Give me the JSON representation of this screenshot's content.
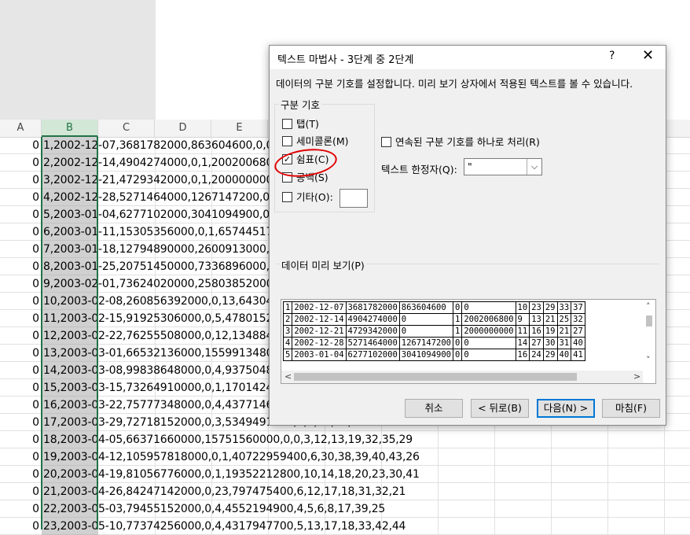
{
  "spreadsheet": {
    "columns": [
      "A",
      "B",
      "C",
      "D",
      "E"
    ],
    "rows": [
      {
        "a": "0",
        "text": "1,2002-12-07,3681782000,863604600,0,0,10"
      },
      {
        "a": "0",
        "text": "2,2002-12-14,4904274000,0,1,2002006800,9"
      },
      {
        "a": "0",
        "text": "3,2002-12-21,4729342000,0,1,2000000000,1"
      },
      {
        "a": "0",
        "text": "4,2002-12-28,5271464000,1267147200,0,0,1"
      },
      {
        "a": "0",
        "text": "5,2003-01-04,6277102000,3041094900,0,0,1"
      },
      {
        "a": "0",
        "text": "6,2003-01-11,15305356000,0,1,6574451700,"
      },
      {
        "a": "0",
        "text": "7,2003-01-18,12794890000,2600913000,0,0,"
      },
      {
        "a": "0",
        "text": "8,2003-01-25,20751450000,7336896000,0,0,"
      },
      {
        "a": "0",
        "text": "9,2003-02-01,73624020000,25803852000,0,0"
      },
      {
        "a": "0",
        "text": "10,2003-02-08,260856392000,0,13,64304379"
      },
      {
        "a": "0",
        "text": "11,2003-02-15,91925306000,0,5,4780152300"
      },
      {
        "a": "0",
        "text": "12,2003-02-22,76255508000,0,12,13488457"
      },
      {
        "a": "0",
        "text": "13,2003-03-01,66532136000,15599134800,0"
      },
      {
        "a": "0",
        "text": "14,2003-03-08,99838648000,0,4,9375048300"
      },
      {
        "a": "0",
        "text": "15,2003-03-15,73264910000,0,1,1701424500"
      },
      {
        "a": "0",
        "text": "16,2003-03-22,75777348000,0,4,4377146100"
      },
      {
        "a": "0",
        "text": "17,2003-03-29,72718152000,0,3,5349491200,1,4,18,23,31"
      },
      {
        "a": "0",
        "text": "18,2003-04-05,66371660000,15751560000,0,0,3,12,13,19,32,35,29"
      },
      {
        "a": "0",
        "text": "19,2003-04-12,105957818000,0,1,40722959400,6,30,38,39,40,43,26"
      },
      {
        "a": "0",
        "text": "20,2003-04-19,81056776000,0,1,19352212800,10,14,18,20,23,30,41"
      },
      {
        "a": "0",
        "text": "21,2003-04-26,84247142000,0,23,797475400,6,12,17,18,31,32,21"
      },
      {
        "a": "0",
        "text": "22,2003-05-03,79455152000,0,4,4552194900,4,5,6,8,17,39,25"
      },
      {
        "a": "0",
        "text": "23,2003-05-10,77374256000,0,4,4317947700,5,13,17,18,33,42,44"
      }
    ]
  },
  "dialog": {
    "title": "텍스트 마법사 - 3단계 중 2단계",
    "help": "?",
    "close": "✕",
    "description": "데이터의 구분 기호를 설정합니다. 미리 보기 상자에서 적용된 텍스트를 볼 수 있습니다.",
    "delimiters_label": "구분 기호",
    "delimiters": [
      {
        "label": "탭(T)",
        "checked": false
      },
      {
        "label": "세미콜론(M)",
        "checked": false
      },
      {
        "label": "쉼표(C)",
        "checked": true
      },
      {
        "label": "공백(S)",
        "checked": false
      },
      {
        "label": "기타(O):",
        "checked": false
      }
    ],
    "consecutive_label": "연속된 구분 기호를 하나로 처리(R)",
    "qualifier_label": "텍스트 한정자(Q):",
    "qualifier_value": "\"",
    "preview_label": "데이터 미리 보기(P)",
    "preview_rows": [
      [
        "1",
        "2002-12-07",
        "3681782000",
        "863604600",
        "0",
        "0",
        "10",
        "23",
        "29",
        "33",
        "37"
      ],
      [
        "2",
        "2002-12-14",
        "4904274000",
        "0",
        "1",
        "2002006800",
        "9",
        "13",
        "21",
        "25",
        "32"
      ],
      [
        "3",
        "2002-12-21",
        "4729342000",
        "0",
        "1",
        "2000000000",
        "11",
        "16",
        "19",
        "21",
        "27"
      ],
      [
        "4",
        "2002-12-28",
        "5271464000",
        "1267147200",
        "0",
        "0",
        "14",
        "27",
        "30",
        "31",
        "40"
      ],
      [
        "5",
        "2003-01-04",
        "6277102000",
        "3041094900",
        "0",
        "0",
        "16",
        "24",
        "29",
        "40",
        "41"
      ]
    ],
    "buttons": {
      "cancel": "취소",
      "back": "< 뒤로(B)",
      "next": "다음(N) >",
      "finish": "마침(F)"
    }
  },
  "colors": {
    "selection_green": "#217346",
    "annotation_red": "#e00000",
    "default_button_blue": "#0078d7"
  }
}
